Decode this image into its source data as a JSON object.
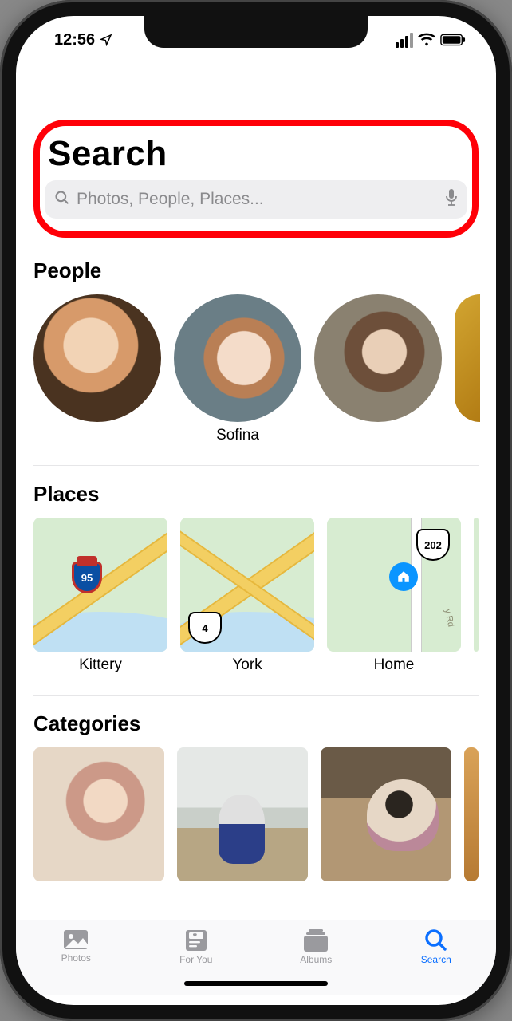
{
  "status": {
    "time": "12:56"
  },
  "header": {
    "title": "Search"
  },
  "search": {
    "placeholder": "Photos, People, Places..."
  },
  "people": {
    "heading": "People",
    "items": [
      {
        "name": ""
      },
      {
        "name": "Sofina"
      },
      {
        "name": ""
      }
    ]
  },
  "places": {
    "heading": "Places",
    "items": [
      {
        "name": "Kittery",
        "badge": "95"
      },
      {
        "name": "York",
        "badge": "4"
      },
      {
        "name": "Home",
        "badge": "202"
      }
    ]
  },
  "categories": {
    "heading": "Categories"
  },
  "tabs": [
    {
      "label": "Photos"
    },
    {
      "label": "For You"
    },
    {
      "label": "Albums"
    },
    {
      "label": "Search"
    }
  ],
  "active_tab": "Search"
}
